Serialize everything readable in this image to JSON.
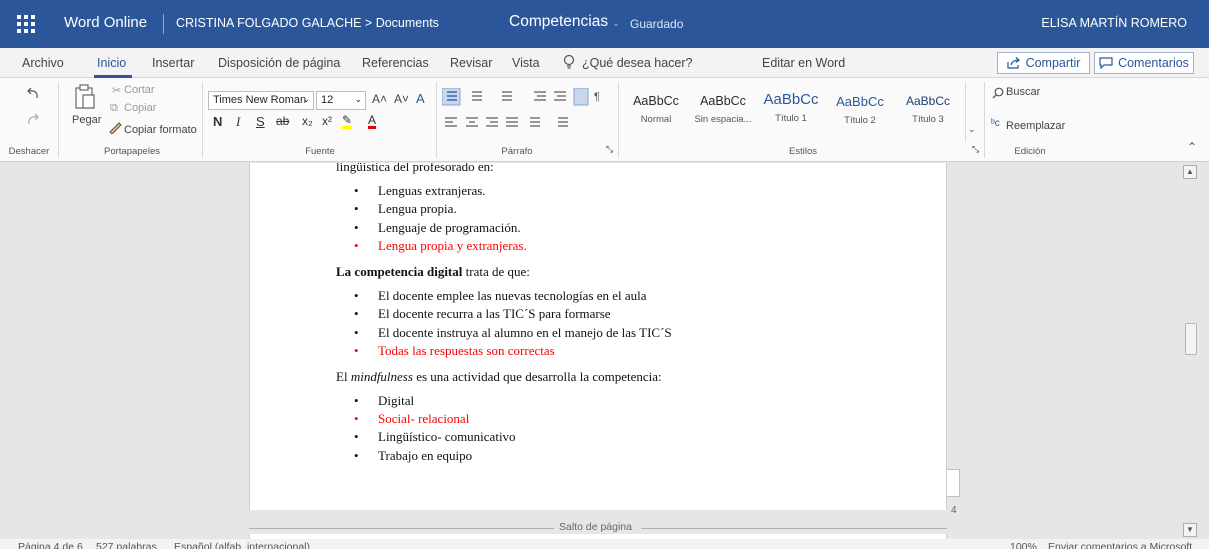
{
  "titlebar": {
    "app_name": "Word Online",
    "breadcrumb": "CRISTINA FOLGADO GALACHE > Documents",
    "doc_title": "Competencias",
    "doc_separator": "-",
    "doc_status": "Guardado",
    "user_name": "ELISA MARTÍN ROMERO"
  },
  "tabs": [
    {
      "label": "Archivo"
    },
    {
      "label": "Inicio"
    },
    {
      "label": "Insertar"
    },
    {
      "label": "Disposición de página"
    },
    {
      "label": "Referencias"
    },
    {
      "label": "Revisar"
    },
    {
      "label": "Vista"
    }
  ],
  "active_tab": "Inicio",
  "tell_me": "¿Qué desea hacer?",
  "edit_in_word": "Editar en Word",
  "share_label": "Compartir",
  "comments_label": "Comentarios",
  "ribbon": {
    "undo_group": "Deshacer",
    "clipboard": {
      "paste": "Pegar",
      "cut": "Cortar",
      "copy": "Copiar",
      "format_painter": "Copiar formato",
      "group": "Portapapeles"
    },
    "font": {
      "family": "Times New Roman",
      "size": "12",
      "group": "Fuente"
    },
    "paragraph_group": "Párrafo",
    "styles": [
      {
        "sample": "AaBbCc",
        "name": "Normal"
      },
      {
        "sample": "AaBbCc",
        "name": "Sin espacia..."
      },
      {
        "sample": "AaBbCc",
        "name": "Título 1"
      },
      {
        "sample": "AaBbCc",
        "name": "Título 2"
      },
      {
        "sample": "AaBbCc",
        "name": "Título 3"
      }
    ],
    "styles_group": "Estilos",
    "editing": {
      "find": "Buscar",
      "replace": "Reemplazar",
      "group": "Edición"
    }
  },
  "document": {
    "intro_line": "lingüística del profesorado en:",
    "list1": [
      {
        "text": "Lenguas extranjeras.",
        "correct": false
      },
      {
        "text": "Lengua propia.",
        "correct": false
      },
      {
        "text": "Lenguaje de programación.",
        "correct": false
      },
      {
        "text": "Lengua propia y extranjeras.",
        "correct": true
      }
    ],
    "q2_bold": "La competencia digital",
    "q2_rest": " trata de que:",
    "list2": [
      {
        "text": "El docente emplee las nuevas tecnologías en el aula",
        "correct": false
      },
      {
        "text": "El docente recurra a las TIC´S para formarse",
        "correct": false
      },
      {
        "text": "El docente instruya al alumno en el manejo de las TIC´S",
        "correct": false
      },
      {
        "text": "Todas las respuestas son correctas",
        "correct": true
      }
    ],
    "q3_pre": "El ",
    "q3_italic": "mindfulness",
    "q3_rest": " es una actividad que desarrolla la competencia:",
    "list3": [
      {
        "text": "Digital",
        "correct": false
      },
      {
        "text": "Social- relacional",
        "correct": true
      },
      {
        "text": "Lingüístico- comunicativo",
        "correct": false
      },
      {
        "text": "Trabajo en equipo",
        "correct": false
      }
    ],
    "page_break": "Salto de página",
    "page_number": "4"
  },
  "statusbar": {
    "page": "Página 4 de 6",
    "words": "527 palabras",
    "language": "Español (alfab. internacional)",
    "zoom": "100%",
    "feedback": "Enviar comentarios a Microsoft"
  },
  "colors": {
    "brand": "#2b579a",
    "correct_answer": "#ff0000"
  }
}
